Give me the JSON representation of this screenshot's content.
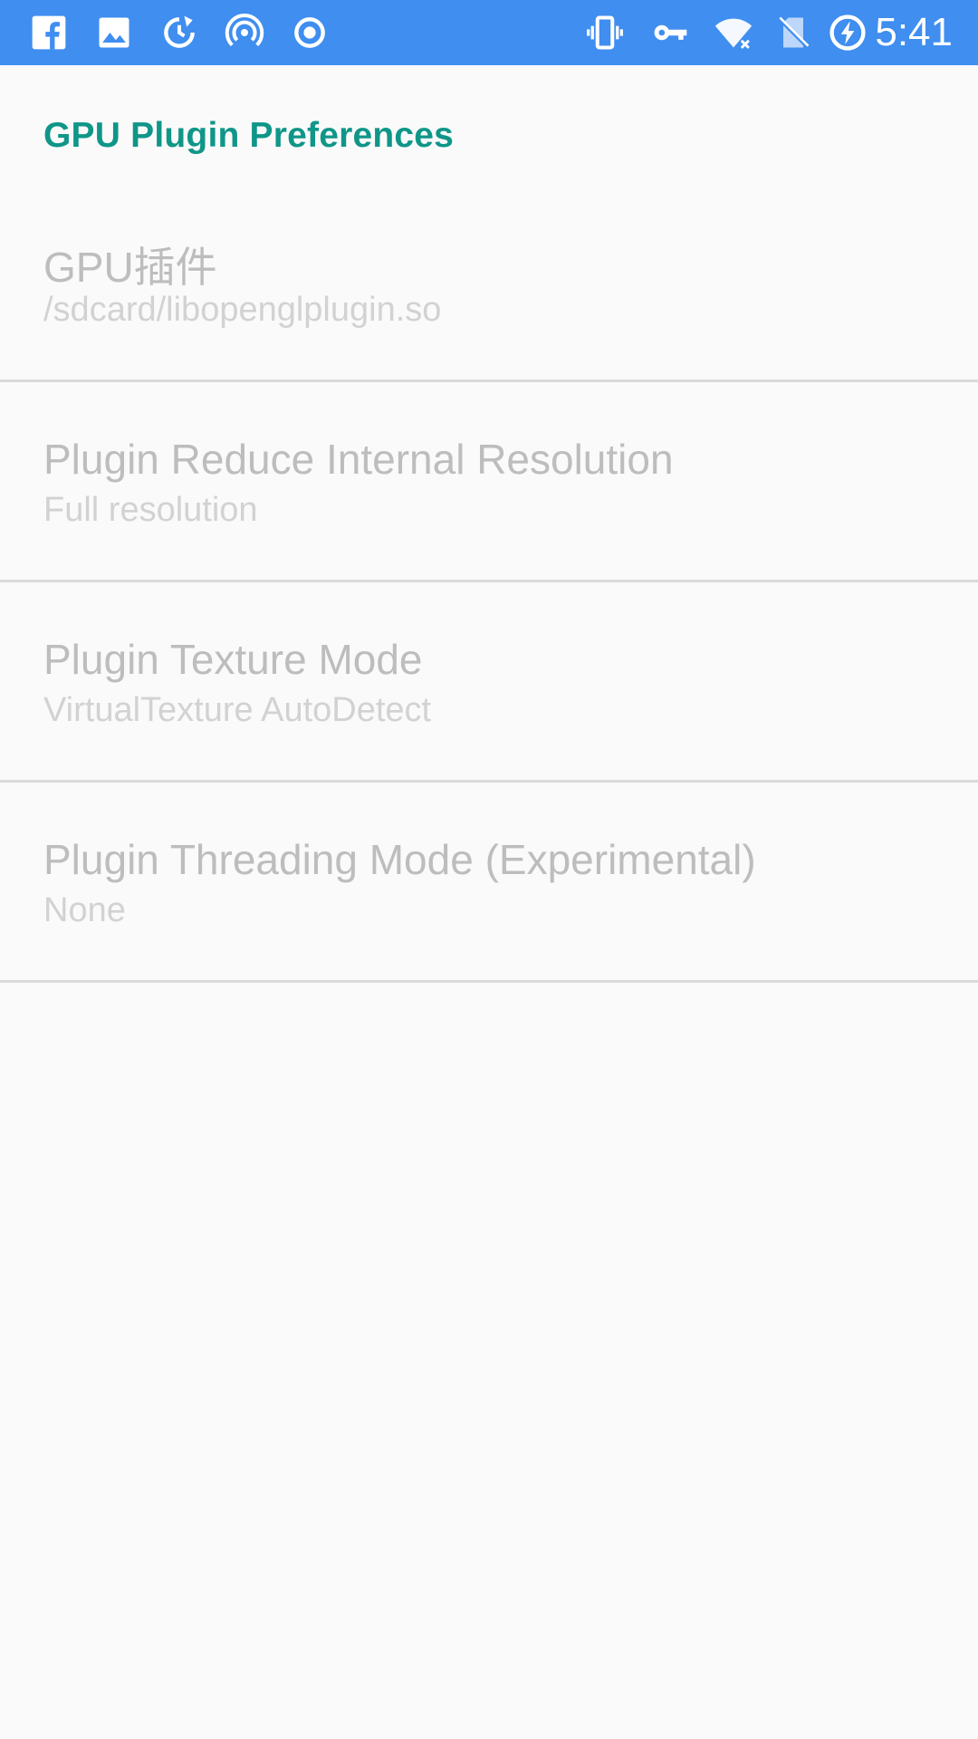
{
  "status_bar": {
    "time": "5:41",
    "left_icons": [
      "facebook-icon",
      "image-icon",
      "sync-icon",
      "hotspot-icon",
      "record-icon"
    ],
    "right_icons": [
      "vibrate-icon",
      "vpn-key-icon",
      "wifi-off-icon",
      "no-sim-icon",
      "battery-charging-icon"
    ],
    "background_color": "#3f8ef0"
  },
  "preferences": {
    "header": "GPU Plugin Preferences",
    "header_color": "#0f9688",
    "items": [
      {
        "title": "GPU插件",
        "summary": "/sdcard/libopenglplugin.so"
      },
      {
        "title": "Plugin Reduce Internal Resolution",
        "summary": "Full resolution"
      },
      {
        "title": "Plugin Texture Mode",
        "summary": "VirtualTexture AutoDetect"
      },
      {
        "title": "Plugin Threading Mode (Experimental)",
        "summary": "None"
      }
    ]
  }
}
